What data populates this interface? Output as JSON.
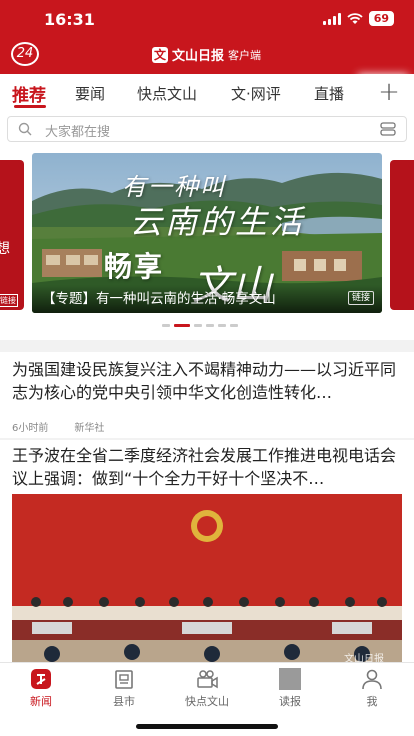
{
  "status": {
    "time": "16:31",
    "battery": "69"
  },
  "header": {
    "date_badge": "24",
    "logo_mark": "文",
    "logo_text": "文山日报",
    "logo_sub": "客户端"
  },
  "tabs": [
    {
      "label": "推荐",
      "active": true
    },
    {
      "label": "要闻"
    },
    {
      "label": "快点文山"
    },
    {
      "label": "文·网评"
    },
    {
      "label": "直播"
    }
  ],
  "tab_add": "+",
  "search": {
    "placeholder": "大家都在搜"
  },
  "carousel": {
    "peek_left_text": "想",
    "peek_left_tag": "链接",
    "overlay": {
      "line1": "有一种叫",
      "line2": "云南的生活",
      "line3": "畅享",
      "line4": "文山"
    },
    "caption": "【专题】有一种叫云南的生活·畅享文山",
    "tag": "链接",
    "dots_total": 6,
    "dots_active": 1
  },
  "news": [
    {
      "title": "为强国建设民族复兴注入不竭精神动力——以习近平同志为核心的党中央引领中华文化创造性转化…",
      "time": "6小时前",
      "source": "新华社"
    },
    {
      "title": "王予波在全省二季度经济社会发展工作推进电视电话会议上强调：做到“十个全力干好十个坚决不…",
      "image_mark": "文山日报"
    }
  ],
  "bottom_nav": [
    {
      "label": "新闻",
      "icon": "news-icon",
      "active": true
    },
    {
      "label": "县市",
      "icon": "county-icon"
    },
    {
      "label": "快点文山",
      "icon": "video-icon"
    },
    {
      "label": "读报",
      "icon": "newspaper-icon"
    },
    {
      "label": "我",
      "icon": "profile-icon"
    }
  ],
  "colors": {
    "brand": "#c8161d"
  }
}
